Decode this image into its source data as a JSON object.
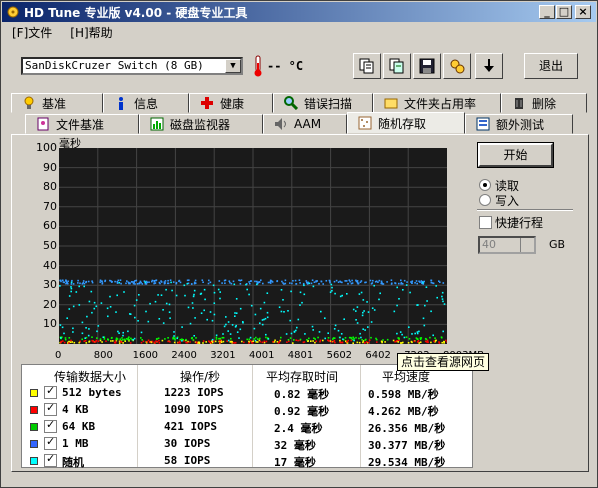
{
  "window": {
    "title": "HD Tune 专业版 v4.00 - 硬盘专业工具",
    "min": "_",
    "max": "□",
    "close": "×"
  },
  "menu": [
    {
      "label": "[F]文件"
    },
    {
      "label": "[H]帮助"
    }
  ],
  "toolbar": {
    "drive": "SanDiskCruzer Switch (8 GB)",
    "temperature": "-- °C",
    "exit_label": "退出",
    "buttons": [
      "copy-icon",
      "copy-text-icon",
      "save-icon",
      "settings-icon",
      "download-icon"
    ]
  },
  "tabs_row1": [
    {
      "label": "基准",
      "icon": "benchmark-icon"
    },
    {
      "label": "信息",
      "icon": "info-icon"
    },
    {
      "label": "健康",
      "icon": "health-icon"
    },
    {
      "label": "错误扫描",
      "icon": "error-scan-icon"
    },
    {
      "label": "文件夹占用率",
      "icon": "folder-usage-icon"
    },
    {
      "label": "删除",
      "icon": "erase-icon"
    }
  ],
  "tabs_row2": [
    {
      "label": "文件基准",
      "icon": "file-benchmark-icon"
    },
    {
      "label": "磁盘监视器",
      "icon": "disk-monitor-icon"
    },
    {
      "label": "AAM",
      "icon": "aam-icon"
    },
    {
      "label": "随机存取",
      "icon": "random-access-icon",
      "active": true
    },
    {
      "label": "额外测试",
      "icon": "extra-tests-icon"
    }
  ],
  "controls": {
    "start_label": "开始",
    "read_label": "读取",
    "write_label": "写入",
    "mode": "read",
    "quick_label": "快捷行程",
    "quick_checked": false,
    "quick_value": "40",
    "quick_unit": "GB"
  },
  "chart_data": {
    "type": "scatter",
    "ylabel": "毫秒",
    "ylim": [
      0,
      100
    ],
    "yticks": [
      "100",
      "90",
      "80",
      "70",
      "60",
      "50",
      "40",
      "30",
      "20",
      "10"
    ],
    "xlim": [
      0,
      8003
    ],
    "xticks": [
      "0",
      "800",
      "1600",
      "2400",
      "3201",
      "4001",
      "4801",
      "5602",
      "6402",
      "7202",
      "8003MB"
    ],
    "grid": true,
    "series": [
      {
        "name": "512 bytes",
        "color": "#ffff00",
        "level_ms": 0.82
      },
      {
        "name": "4 KB",
        "color": "#ff0000",
        "level_ms": 0.92
      },
      {
        "name": "64 KB",
        "color": "#00ff00",
        "level_ms": 2.4
      },
      {
        "name": "1 MB",
        "color": "#3399ff",
        "level_ms": 32
      },
      {
        "name": "随机",
        "color": "#00ffff",
        "level_ms": 17
      }
    ]
  },
  "results": {
    "headers": [
      "传输数据大小",
      "操作/秒",
      "平均存取时间",
      "平均速度"
    ],
    "rows": [
      {
        "size": "512 bytes",
        "iops": "1223 IOPS",
        "access": "0.82 毫秒",
        "speed": "0.598 MB/秒",
        "color": "#ffff00"
      },
      {
        "size": "4 KB",
        "iops": "1090 IOPS",
        "access": "0.92 毫秒",
        "speed": "4.262 MB/秒",
        "color": "#ff0000"
      },
      {
        "size": "64 KB",
        "iops": "421 IOPS",
        "access": "2.4 毫秒",
        "speed": "26.356 MB/秒",
        "color": "#00cc00"
      },
      {
        "size": "1 MB",
        "iops": "30 IOPS",
        "access": "32 毫秒",
        "speed": "30.377 MB/秒",
        "color": "#3366ff"
      },
      {
        "size": "随机",
        "iops": "58 IOPS",
        "access": "17 毫秒",
        "speed": "29.534 MB/秒",
        "color": "#00ffff"
      }
    ]
  },
  "tooltip": "点击查看源网页"
}
